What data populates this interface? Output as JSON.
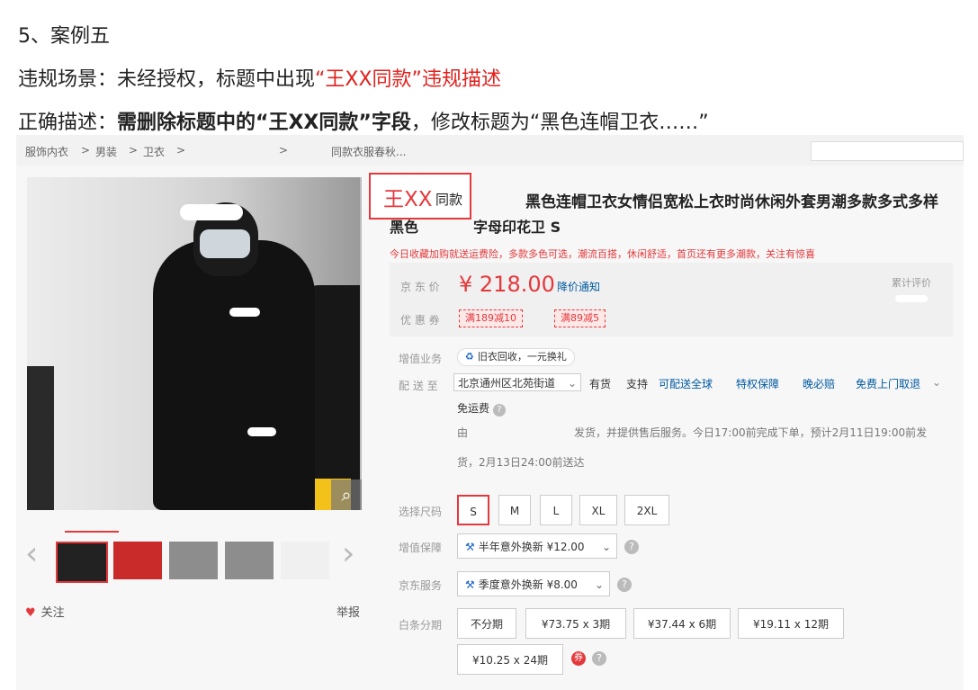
{
  "heading": {
    "case_title": "5、案例五",
    "scenario_prefix": "违规场景：未经授权，标题中出现",
    "scenario_red": "“王XX同款”违规描述",
    "correct_prefix": "正确描述：",
    "correct_bold": "需删除标题中的“王XX同款”字段",
    "correct_suffix": "，修改标题为“黑色连帽卫衣……”"
  },
  "breadcrumb": {
    "items": [
      "服饰内衣",
      ">",
      "男装",
      ">",
      "卫衣",
      ">",
      ">",
      "同款衣服春秋..."
    ]
  },
  "product": {
    "title_highlight": "王XX",
    "title_highlight_suffix": "同款",
    "title_rest": "黑色连帽卫衣女情侣宽松上衣时尚休闲外套男潮多款多式多样",
    "title_line2a": "黑色",
    "title_line2b": "字母印花卫 S",
    "promo": "今日收藏加购就送运费险，多款多色可选，潮流百搭，休闲舒适，首页还有更多潮款，关注有惊喜"
  },
  "price": {
    "label": "京 东 价",
    "value": "¥ 218.00",
    "notify": "降价通知",
    "coupon_label": "优 惠 券",
    "coupons": [
      "满189减10",
      "满89减5"
    ],
    "review_label": "累计评价"
  },
  "service": {
    "tradein_label": "增值业务",
    "tradein_text": "旧衣回收，一元换礼",
    "delivery_label": "配 送 至",
    "address": "北京通州区北苑街道",
    "stock": "有货",
    "support": "支持",
    "link_global": "可配送全球",
    "link_privilege": "特权保障",
    "link_late": "晚必赔",
    "link_pickup": "免费上门取退",
    "free_shipping": "免运费",
    "ship_from": "由",
    "ship_line1": "发货，并提供售后服务。今日17:00前完成下单，预计2月11日19:00前发",
    "ship_line2": "货，2月13日24:00前送达"
  },
  "options": {
    "size_label": "选择尺码",
    "sizes": [
      "S",
      "M",
      "L",
      "XL",
      "2XL"
    ],
    "value_protect_label": "增值保障",
    "value_protect_item": "半年意外换新 ¥12.00",
    "jd_service_label": "京东服务",
    "jd_service_item": "季度意外换新 ¥8.00",
    "installment_label": "白条分期",
    "installments": [
      "不分期",
      "¥73.75 x 3期",
      "¥37.44 x 6期",
      "¥19.11 x 12期",
      "¥10.25 x 24期"
    ]
  },
  "gallery": {
    "follow": "关注",
    "report": "举报"
  },
  "icons": [
    "chevron-left-icon",
    "chevron-right-icon",
    "heart-icon",
    "zoom-icon",
    "question-icon",
    "tool-icon",
    "recycle-icon",
    "chevron-down-icon"
  ],
  "colors": {
    "accent_red": "#e4393c",
    "link_blue": "#005aa0"
  }
}
